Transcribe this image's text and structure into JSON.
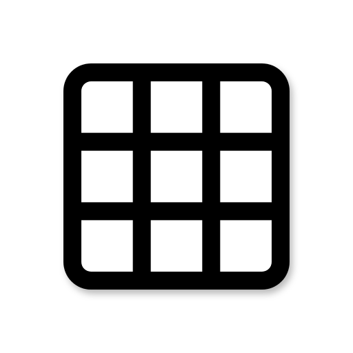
{
  "icon": {
    "name": "grid-icon",
    "rows": 3,
    "columns": 3,
    "stroke_color": "#000000",
    "cell_color": "#ffffff",
    "background_color": "#ffffff"
  }
}
